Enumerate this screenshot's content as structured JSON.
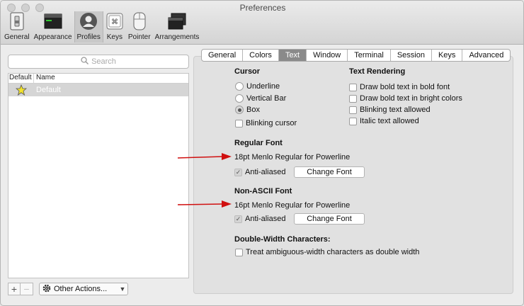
{
  "window": {
    "title": "Preferences"
  },
  "toolbar": {
    "items": [
      {
        "label": "General",
        "icon": "switch-icon"
      },
      {
        "label": "Appearance",
        "icon": "window-icon"
      },
      {
        "label": "Profiles",
        "icon": "person-icon",
        "selected": true
      },
      {
        "label": "Keys",
        "icon": "keyboard-icon"
      },
      {
        "label": "Pointer",
        "icon": "mouse-icon"
      },
      {
        "label": "Arrangements",
        "icon": "windows-icon"
      }
    ]
  },
  "profiles": {
    "search_placeholder": "Search",
    "col_default": "Default",
    "col_name": "Name",
    "rows": [
      {
        "name": "Default",
        "is_default": true
      }
    ],
    "add": "+",
    "remove": "−",
    "other_actions": "Other Actions..."
  },
  "tabs": [
    "General",
    "Colors",
    "Text",
    "Window",
    "Terminal",
    "Session",
    "Keys",
    "Advanced"
  ],
  "selected_tab": "Text",
  "text": {
    "cursor": {
      "heading": "Cursor",
      "underline": "Underline",
      "vertical_bar": "Vertical Bar",
      "box": "Box",
      "blinking": "Blinking cursor"
    },
    "rendering": {
      "heading": "Text Rendering",
      "bold_font": "Draw bold text in bold font",
      "bright_colors": "Draw bold text in bright colors",
      "blinking_allowed": "Blinking text allowed",
      "italic_allowed": "Italic text allowed"
    },
    "regular_font": {
      "heading": "Regular Font",
      "value": "18pt Menlo Regular for Powerline",
      "antialiased": "Anti-aliased",
      "change": "Change Font"
    },
    "non_ascii_font": {
      "heading": "Non-ASCII Font",
      "value": "16pt Menlo Regular for Powerline",
      "antialiased": "Anti-aliased",
      "change": "Change Font"
    },
    "double_width": {
      "heading": "Double-Width Characters:",
      "treat": "Treat ambiguous-width characters as double width"
    }
  },
  "colors": {
    "annotation_arrow": "#d01010",
    "selected_tab": "#8a8a8a"
  }
}
